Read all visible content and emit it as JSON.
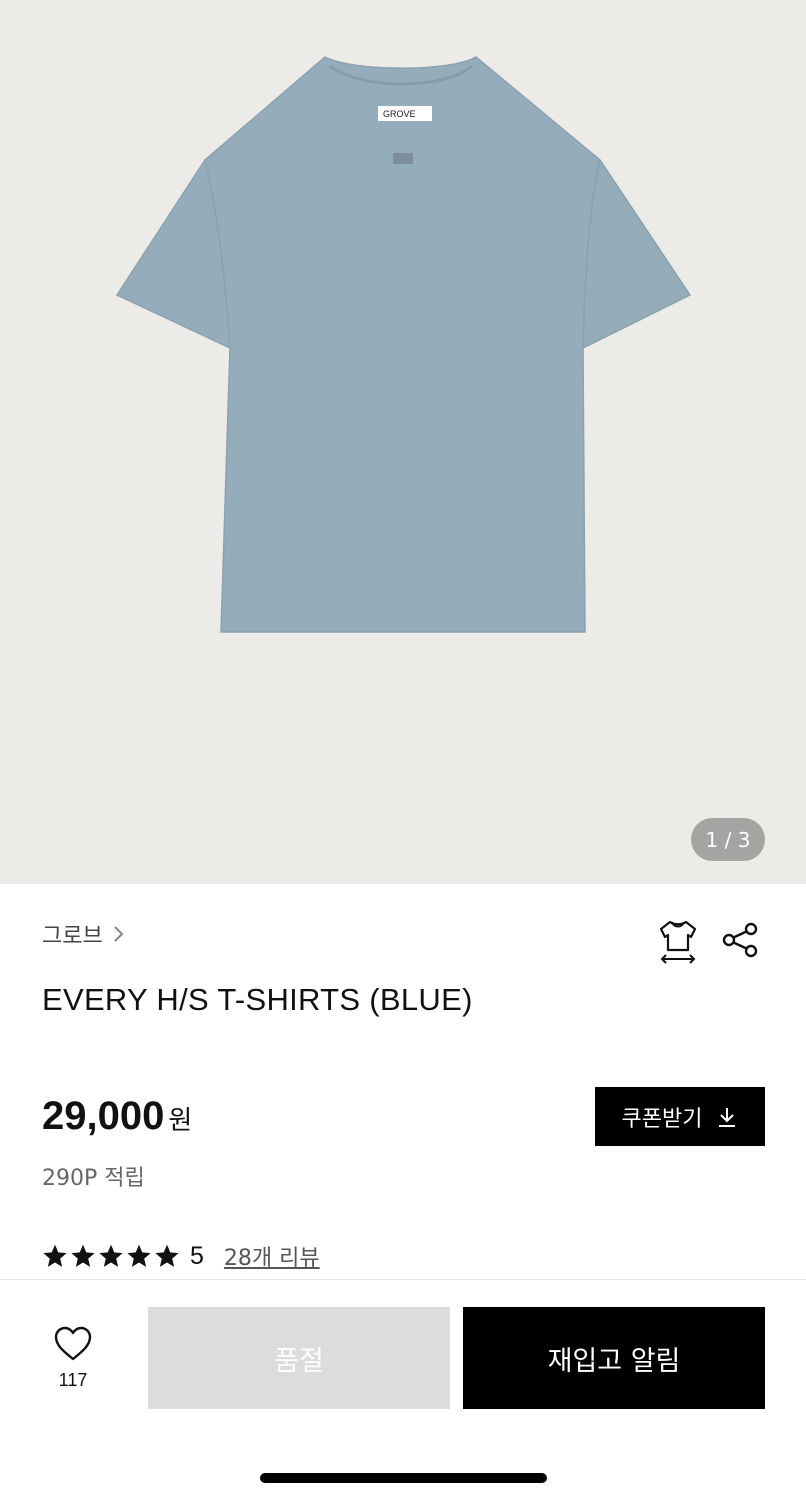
{
  "gallery": {
    "tag_text": "GROVE",
    "pager": "1 / 3"
  },
  "product": {
    "brand": "그로브",
    "title": "EVERY H/S T-SHIRTS (BLUE)",
    "price": "29,000",
    "currency": "원",
    "points": "290P 적립",
    "rating_value": "5",
    "rating_stars": 5,
    "review_link": "28개 리뷰"
  },
  "actions": {
    "coupon_label": "쿠폰받기",
    "wish_count": "117",
    "soldout_label": "품절",
    "restock_label": "재입고 알림"
  },
  "icons": {
    "brand_chevron": "chevron-right-icon",
    "size_guide": "tshirt-size-icon",
    "share": "share-icon",
    "coupon_download": "download-icon",
    "star": "star-icon",
    "wishlist": "heart-icon"
  },
  "colors": {
    "hero_background": "#ecebe7",
    "shirt_color": "#95acba",
    "primary_button": "#000000",
    "disabled_button": "#dcdcdc"
  }
}
